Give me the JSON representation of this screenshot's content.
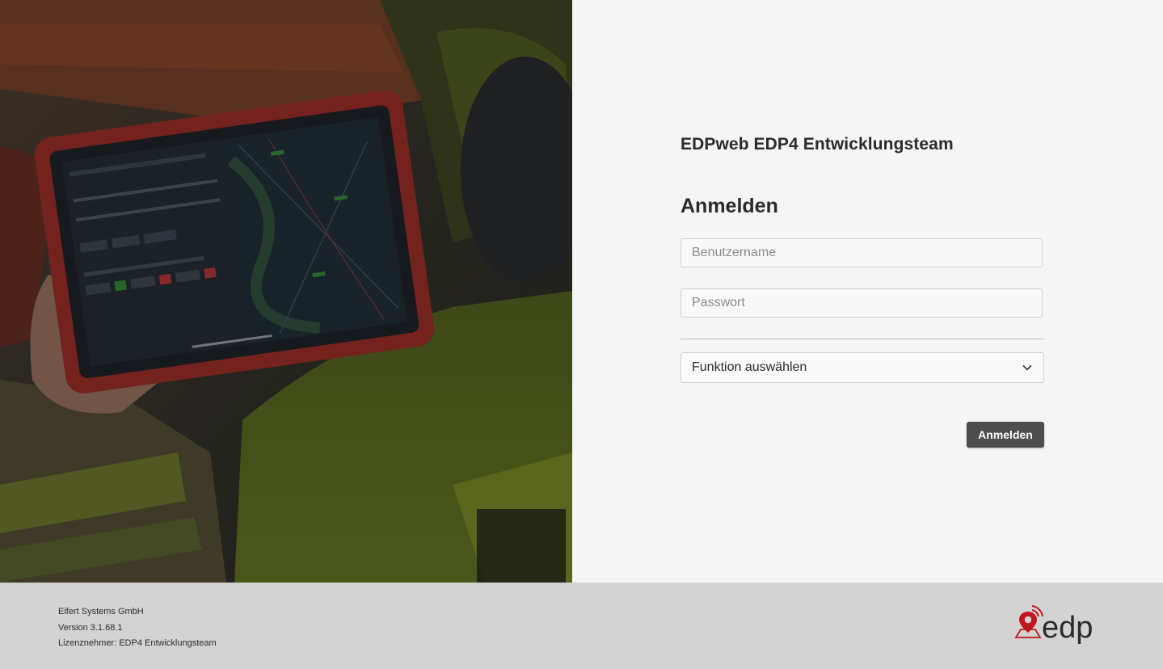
{
  "org": {
    "title": "EDPweb EDP4 Entwicklungsteam"
  },
  "login": {
    "heading": "Anmelden",
    "username_placeholder": "Benutzername",
    "password_placeholder": "Passwort",
    "function_select": {
      "selected": "Funktion auswählen"
    },
    "submit_label": "Anmelden"
  },
  "footer": {
    "company": "Eifert Systems GmbH",
    "version": "Version 3.1.68.1",
    "licensee": "Lizenznehmer: EDP4 Entwicklungsteam"
  },
  "brand": {
    "logo_text": "edp",
    "accent": "#c0161d"
  },
  "colors": {
    "button": "#4d4d4d",
    "footer_bg": "#d3d3d3",
    "panel_bg": "#f5f5f5"
  },
  "icons": {
    "select": "chevron-down-icon",
    "logo": "location-pin-icon"
  }
}
